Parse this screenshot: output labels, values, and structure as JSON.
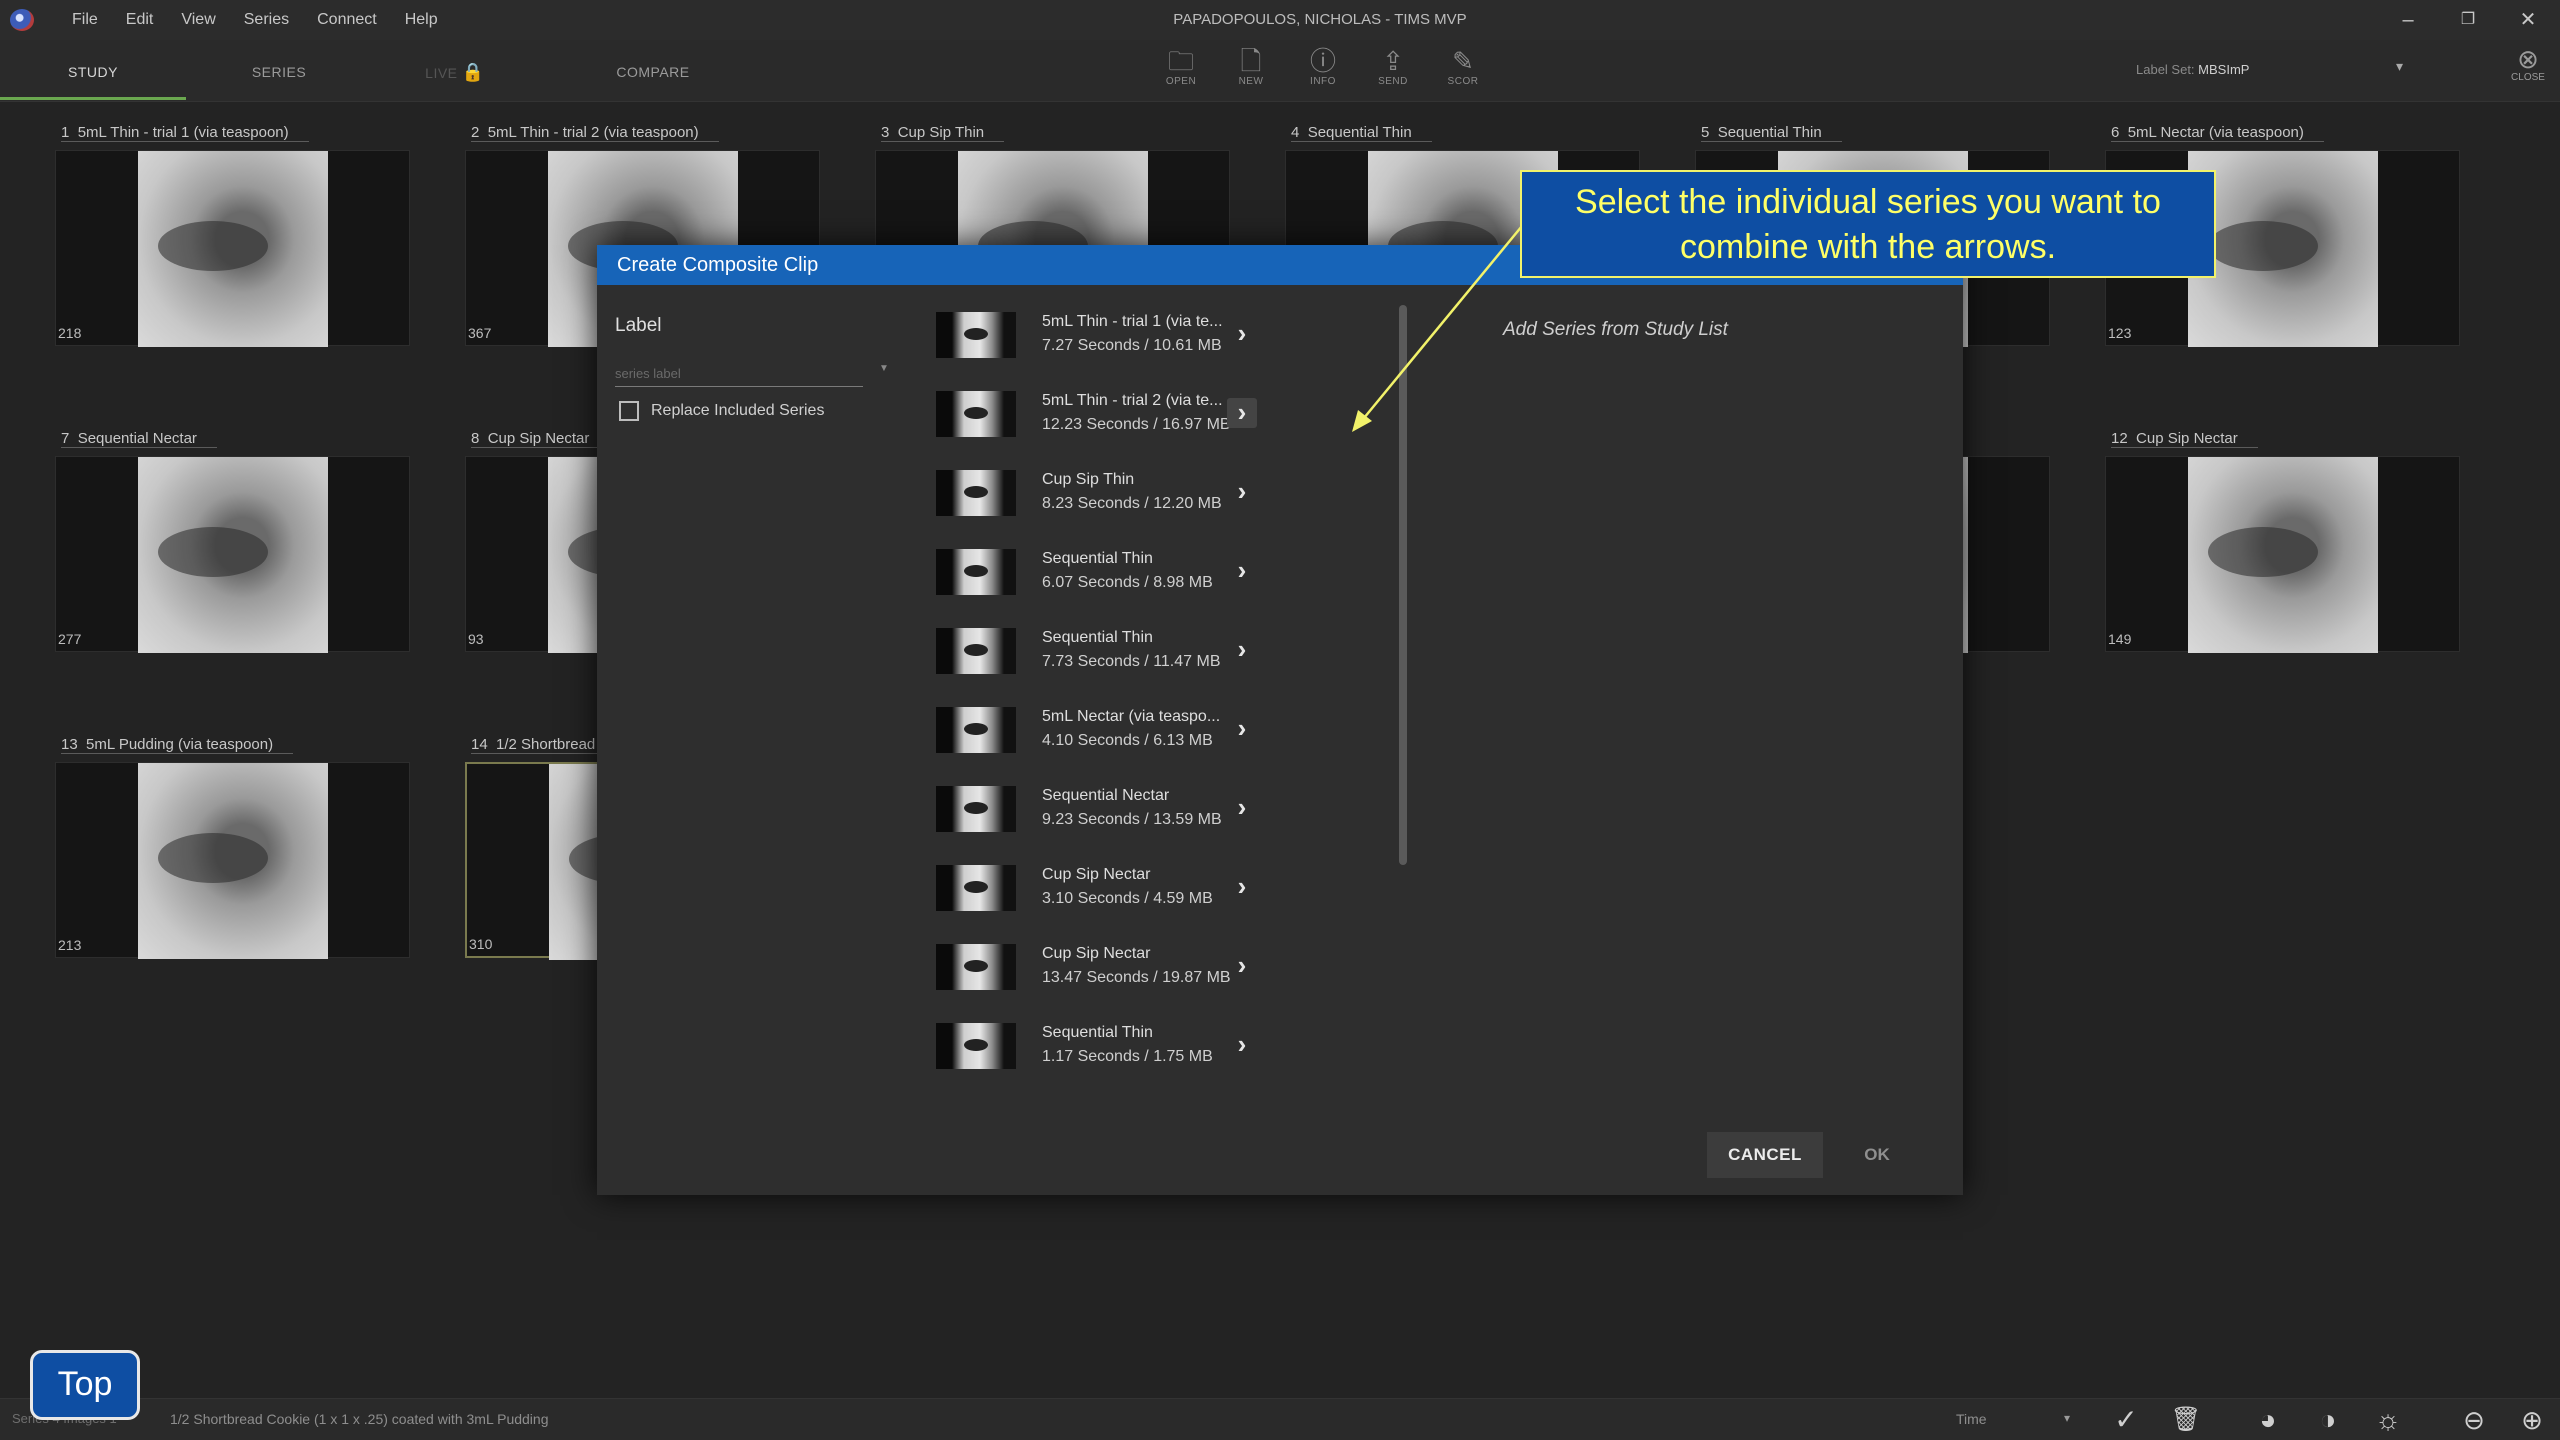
{
  "window": {
    "title": "PAPADOPOULOS, NICHOLAS - TIMS MVP",
    "menu": [
      "File",
      "Edit",
      "View",
      "Series",
      "Connect",
      "Help"
    ],
    "controls": {
      "minimize": "–",
      "restore": "❐",
      "close": "✕"
    }
  },
  "toolbar": {
    "tabs": [
      "STUDY",
      "SERIES",
      "LIVE",
      "COMPARE"
    ],
    "active_tab": "STUDY",
    "buttons": [
      {
        "label": "OPEN",
        "icon": "folder-icon",
        "glyph": "🗀"
      },
      {
        "label": "NEW",
        "icon": "new-document-icon",
        "glyph": "🗋"
      },
      {
        "label": "INFO",
        "icon": "info-icon",
        "glyph": "ⓘ"
      },
      {
        "label": "SEND",
        "icon": "share-icon",
        "glyph": "⇪"
      },
      {
        "label": "SCOR",
        "icon": "score-icon",
        "glyph": "✎"
      }
    ],
    "label_set_prefix": "Label Set:",
    "label_set_value": "MBSImP",
    "close_label": "CLOSE"
  },
  "study_tiles": [
    {
      "index": "1",
      "label": "5mL Thin - trial 1 (via teaspoon)",
      "count": "218"
    },
    {
      "index": "2",
      "label": "5mL Thin - trial 2 (via teaspoon)",
      "count": "367"
    },
    {
      "index": "3",
      "label": "Cup Sip Thin",
      "count": ""
    },
    {
      "index": "4",
      "label": "Sequential Thin",
      "count": ""
    },
    {
      "index": "5",
      "label": "Sequential Thin",
      "count": ""
    },
    {
      "index": "6",
      "label": "5mL Nectar (via teaspoon)",
      "count": "123"
    },
    {
      "index": "7",
      "label": "Sequential Nectar",
      "count": "277"
    },
    {
      "index": "8",
      "label": "Cup Sip Nectar",
      "count": "93"
    },
    {
      "index": "12",
      "label": "Cup Sip Nectar",
      "count": "149"
    },
    {
      "index": "13",
      "label": "5mL Pudding (via teaspoon)",
      "count": "213"
    },
    {
      "index": "14",
      "label": "1/2 Shortbread",
      "count": "310"
    }
  ],
  "dialog": {
    "title": "Create Composite Clip",
    "label_heading": "Label",
    "label_placeholder": "series label",
    "replace_checkbox_label": "Replace Included Series",
    "replace_checked": false,
    "right_panel_text": "Add Series from Study List",
    "cancel_label": "CANCEL",
    "ok_label": "OK",
    "series": [
      {
        "name": "5mL Thin - trial 1 (via te...",
        "info": "7.27 Seconds / 10.61 MB"
      },
      {
        "name": "5mL Thin - trial 2 (via te...",
        "info": "12.23 Seconds / 16.97 MB"
      },
      {
        "name": "Cup Sip Thin",
        "info": "8.23 Seconds / 12.20 MB"
      },
      {
        "name": "Sequential Thin",
        "info": "6.07 Seconds / 8.98 MB"
      },
      {
        "name": "Sequential Thin",
        "info": "7.73 Seconds / 11.47 MB"
      },
      {
        "name": "5mL Nectar (via teaspo...",
        "info": "4.10 Seconds / 6.13 MB"
      },
      {
        "name": "Sequential Nectar",
        "info": "9.23 Seconds / 13.59 MB"
      },
      {
        "name": "Cup Sip Nectar",
        "info": "3.10 Seconds / 4.59 MB"
      },
      {
        "name": "Cup Sip Nectar",
        "info": "13.47 Seconds / 19.87 MB"
      },
      {
        "name": "Sequential Thin",
        "info": "1.17 Seconds / 1.75 MB"
      }
    ],
    "arrow_glyph": "›"
  },
  "callout": {
    "line1": "Select the individual series you want to",
    "line2": "combine with the arrows."
  },
  "statusbar": {
    "left": "Series 4 Images 1",
    "text": "1/2 Shortbread Cookie (1 x 1 x .25) coated with 3mL Pudding",
    "time_label": "Time"
  },
  "top_button": "Top",
  "colors": {
    "dialog_header": "#1764b8",
    "callout_bg": "#0e4ea3",
    "callout_text": "#ffff66",
    "active_tab": "#6aa84f"
  }
}
